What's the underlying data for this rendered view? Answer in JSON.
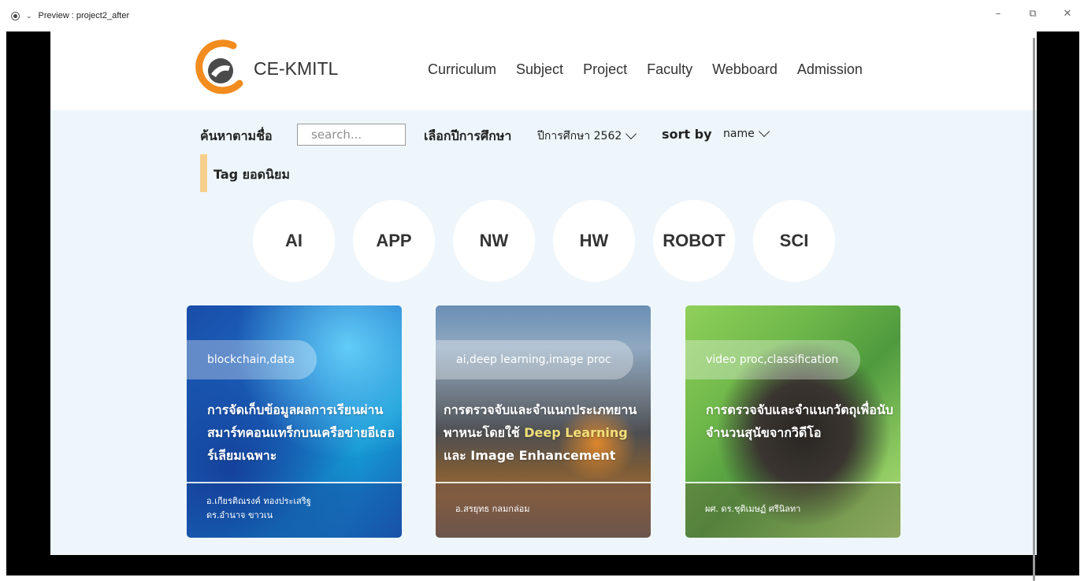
{
  "window": {
    "title": "Preview : project2_after",
    "controls": {
      "minimize": "–",
      "restore": "⧉",
      "close": "✕"
    }
  },
  "brand": {
    "name": "CE-KMITL",
    "logo_colors": {
      "primary": "#f28c1f",
      "dark": "#4a4a4a"
    }
  },
  "nav": {
    "items": [
      "Curriculum",
      "Subject",
      "Project",
      "Faculty",
      "Webboard",
      "Admission"
    ]
  },
  "filter": {
    "search_label": "ค้นหาตามชื่อ",
    "search_placeholder": "search...",
    "year_label": "เลือกปีการศึกษา",
    "year_value": "ปีการศึกษา 2562",
    "sort_label": "sort by",
    "sort_value": "name"
  },
  "tags": {
    "title": "Tag ยอดนิยม",
    "accent_color": "#f7cf8d",
    "items": [
      "AI",
      "APP",
      "NW",
      "HW",
      "ROBOT",
      "SCI"
    ]
  },
  "projects": [
    {
      "tags": "blockchain,data",
      "title": "การจัดเก็บข้อมูลผลการเรียนผ่านสมาร์ทคอนแทร็กบนเครือข่ายอีเธอร์เลียมเฉพาะ",
      "authors": [
        "อ.เกียรติณรงค์ ทองประเสริฐ",
        "ดร.อำนาจ ขาวเน"
      ]
    },
    {
      "tags": "ai,deep learning,image proc",
      "title_main": "การตรวจจับและจำแนกประเภทยานพาหนะโดยใช้ ",
      "title_highlight": "Deep Learning",
      "title_end": " และ Image Enhancement",
      "highlight_color": "#f2e07a",
      "authors": [
        "อ.สรยุทธ กลมกล่อม"
      ]
    },
    {
      "tags": "video proc,classification",
      "title": "การตรวจจับและจำแนกวัตถุเพื่อนับจำนวนสุนัขจากวิดีโอ",
      "authors": [
        "ผศ. ดร.ชุติเมษฏ์ ศรีนิลทา"
      ]
    }
  ]
}
